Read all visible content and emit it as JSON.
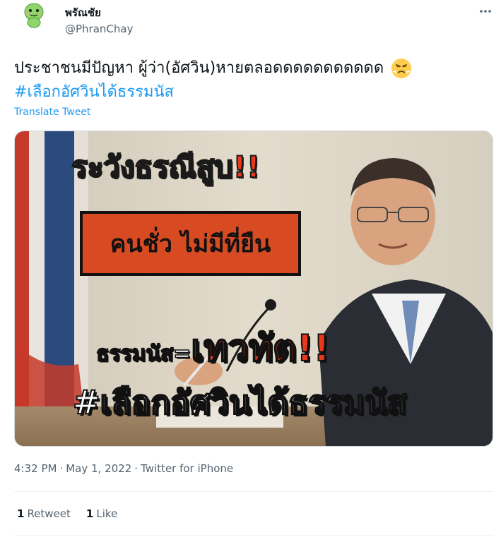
{
  "user": {
    "display_name": "พรัณชัย",
    "handle": "@PhranChay",
    "avatar_icon": "green-cartoon-avatar-icon"
  },
  "tweet": {
    "text_line1": "ประชาชนมีปัญหา ผู้ว่า(อัศวิน)หายตลอดดดดดดดดดดด",
    "emoji": "angry-face-emoji",
    "hashtag": "#เลือกอัศวินได้ธรรมนัส",
    "translate_label": "Translate Tweet"
  },
  "media": {
    "warning_text": "ระวังธรณีสูบ!!",
    "box_text": "คนชั่ว ไม่มีที่ยืน",
    "equation_name": "ธรรมนัส=",
    "equation_result": "เทวทัต!!",
    "hashtag_overlay": "#เลือกอัศวินได้ธรรมนัส"
  },
  "meta": {
    "time": "4:32 PM",
    "separator": "·",
    "date": "May 1, 2022",
    "source": "Twitter for iPhone"
  },
  "stats": {
    "retweets_count": "1",
    "retweets_label": "Retweet",
    "likes_count": "1",
    "likes_label": "Like"
  },
  "colors": {
    "link": "#1d9bf0",
    "secondary_text": "#536471",
    "overlay_red": "#e8391d"
  }
}
